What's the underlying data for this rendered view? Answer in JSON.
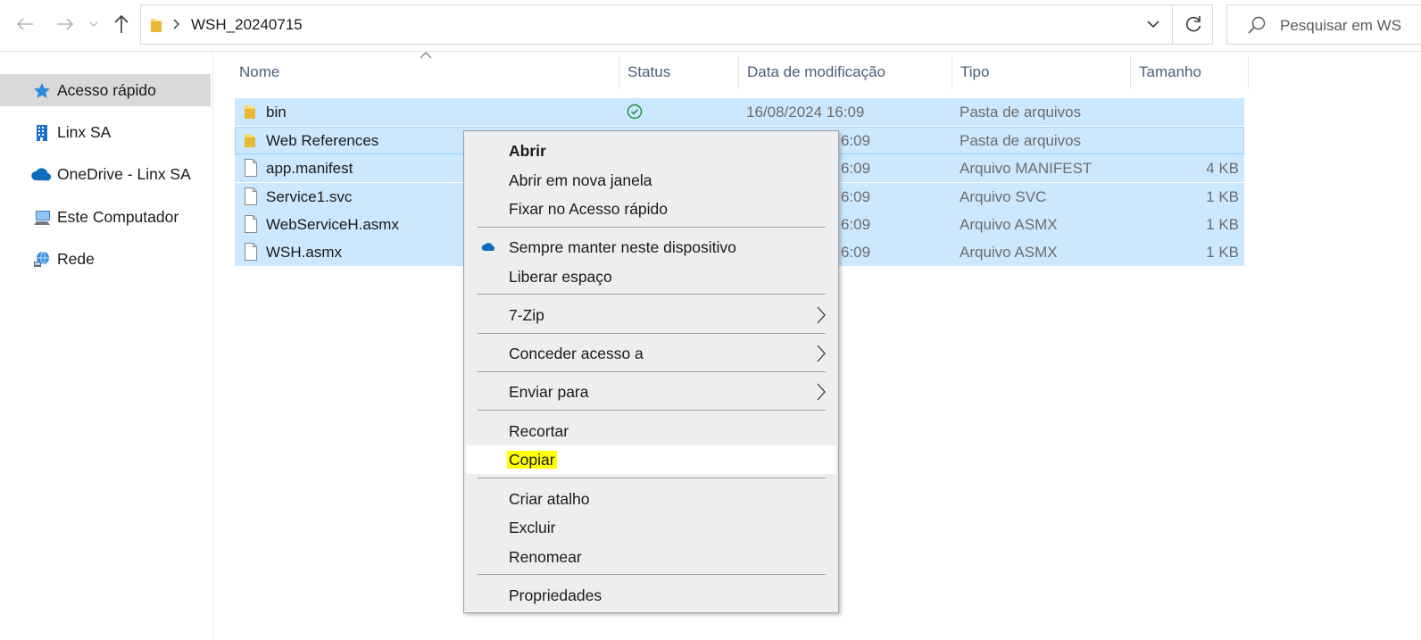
{
  "address": {
    "path": "WSH_20240715"
  },
  "search": {
    "placeholder": "Pesquisar em WS"
  },
  "sidebar": {
    "items": [
      {
        "label": "Acesso rápido",
        "icon": "star-icon"
      },
      {
        "label": "Linx SA",
        "icon": "building-icon"
      },
      {
        "label": "OneDrive - Linx SA",
        "icon": "cloud-icon"
      },
      {
        "label": "Este Computador",
        "icon": "computer-icon"
      },
      {
        "label": "Rede",
        "icon": "network-icon"
      }
    ]
  },
  "columns": {
    "name": "Nome",
    "status": "Status",
    "date": "Data de modificação",
    "type": "Tipo",
    "size": "Tamanho"
  },
  "files": [
    {
      "name": "bin",
      "date": "16/08/2024 16:09",
      "type": "Pasta de arquivos",
      "size": "",
      "icon": "folder-icon",
      "status": "synced-check-icon"
    },
    {
      "name": "Web References",
      "date": "6:09",
      "type": "Pasta de arquivos",
      "size": "",
      "icon": "folder-icon"
    },
    {
      "name": "app.manifest",
      "date": "6:09",
      "type": "Arquivo MANIFEST",
      "size": "4 KB",
      "icon": "file-icon"
    },
    {
      "name": "Service1.svc",
      "date": "6:09",
      "type": "Arquivo SVC",
      "size": "1 KB",
      "icon": "file-icon"
    },
    {
      "name": "WebServiceH.asmx",
      "date": "6:09",
      "type": "Arquivo ASMX",
      "size": "1 KB",
      "icon": "file-icon"
    },
    {
      "name": "WSH.asmx",
      "date": "6:09",
      "type": "Arquivo ASMX",
      "size": "1 KB",
      "icon": "file-icon"
    }
  ],
  "context_menu": {
    "open": "Abrir",
    "open_new_window": "Abrir em nova janela",
    "pin_quick_access": "Fixar no Acesso rápido",
    "always_keep": "Sempre manter neste dispositivo",
    "free_space": "Liberar espaço",
    "seven_zip": "7-Zip",
    "give_access": "Conceder acesso a",
    "send_to": "Enviar para",
    "cut": "Recortar",
    "copy": "Copiar",
    "create_shortcut": "Criar atalho",
    "delete": "Excluir",
    "rename": "Renomear",
    "properties": "Propriedades"
  },
  "colors": {
    "selection": "#cce8ff",
    "highlight": "#ffff00",
    "menu_bg": "#eeeeee",
    "onedrive_blue": "#0f6cbd",
    "folder_yellow": "#f8d775"
  }
}
